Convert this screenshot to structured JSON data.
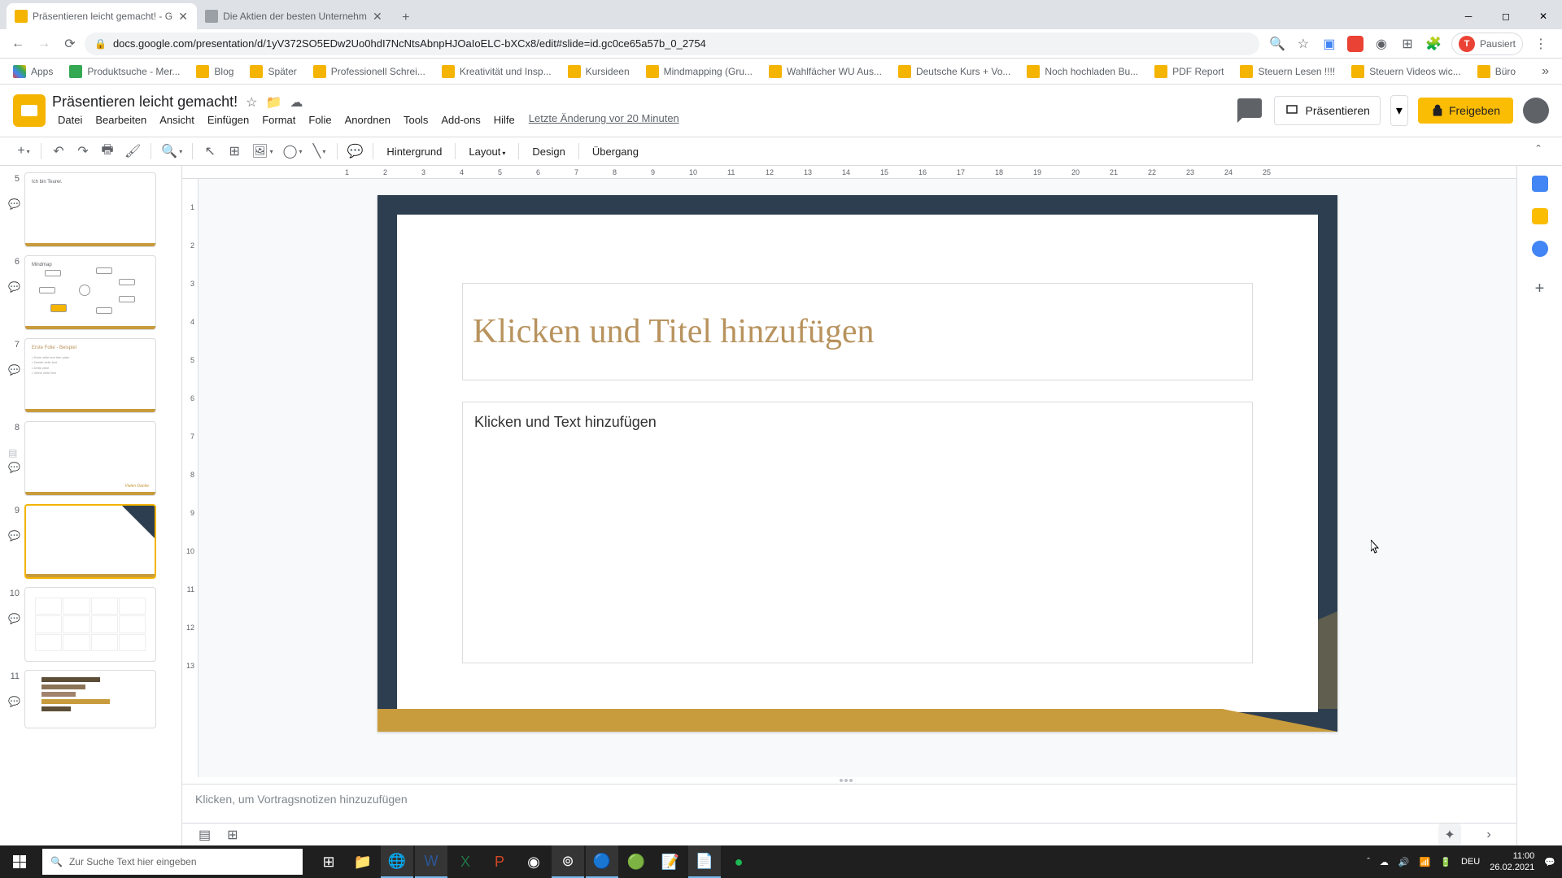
{
  "browser": {
    "tabs": [
      {
        "title": "Präsentieren leicht gemacht! - G",
        "active": true
      },
      {
        "title": "Die Aktien der besten Unternehm",
        "active": false
      }
    ],
    "url": "docs.google.com/presentation/d/1yV372SO5EDw2Uo0hdI7NcNtsAbnpHJOaIoELC-bXCx8/edit#slide=id.gc0ce65a57b_0_2754",
    "profile_status": "Pausiert",
    "profile_letter": "T"
  },
  "bookmarks": [
    "Apps",
    "Produktsuche - Mer...",
    "Blog",
    "Später",
    "Professionell Schrei...",
    "Kreativität und Insp...",
    "Kursideen",
    "Mindmapping  (Gru...",
    "Wahlfächer WU Aus...",
    "Deutsche Kurs + Vo...",
    "Noch hochladen Bu...",
    "PDF Report",
    "Steuern Lesen !!!!",
    "Steuern Videos wic...",
    "Büro"
  ],
  "doc": {
    "title": "Präsentieren leicht gemacht!",
    "last_edit": "Letzte Änderung vor 20 Minuten"
  },
  "menus": [
    "Datei",
    "Bearbeiten",
    "Ansicht",
    "Einfügen",
    "Format",
    "Folie",
    "Anordnen",
    "Tools",
    "Add-ons",
    "Hilfe"
  ],
  "toolbar": {
    "hintergrund": "Hintergrund",
    "layout": "Layout",
    "design": "Design",
    "uebergang": "Übergang"
  },
  "header_btns": {
    "present": "Präsentieren",
    "share": "Freigeben"
  },
  "ruler_h": [
    1,
    2,
    3,
    4,
    5,
    6,
    7,
    8,
    9,
    10,
    11,
    12,
    13,
    14,
    15,
    16,
    17,
    18,
    19,
    20,
    21,
    22,
    23,
    24,
    25
  ],
  "ruler_v": [
    1,
    2,
    3,
    4,
    5,
    6,
    7,
    8,
    9,
    10,
    11,
    12,
    13
  ],
  "slides": [
    {
      "num": 5,
      "label": "Ich bin Teurer."
    },
    {
      "num": 6,
      "label": "Mindmap"
    },
    {
      "num": 7,
      "label": "Erste Folie - Beispiel"
    },
    {
      "num": 8,
      "label": ""
    },
    {
      "num": 9,
      "label": "",
      "selected": true
    },
    {
      "num": 10,
      "label": ""
    },
    {
      "num": 11,
      "label": ""
    }
  ],
  "canvas": {
    "title_placeholder": "Klicken und Titel hinzufügen",
    "body_placeholder": "Klicken und Text hinzufügen"
  },
  "notes_placeholder": "Klicken, um Vortragsnotizen hinzuzufügen",
  "taskbar": {
    "search_placeholder": "Zur Suche Text hier eingeben",
    "lang": "DEU",
    "time": "11:00",
    "date": "26.02.2021"
  }
}
